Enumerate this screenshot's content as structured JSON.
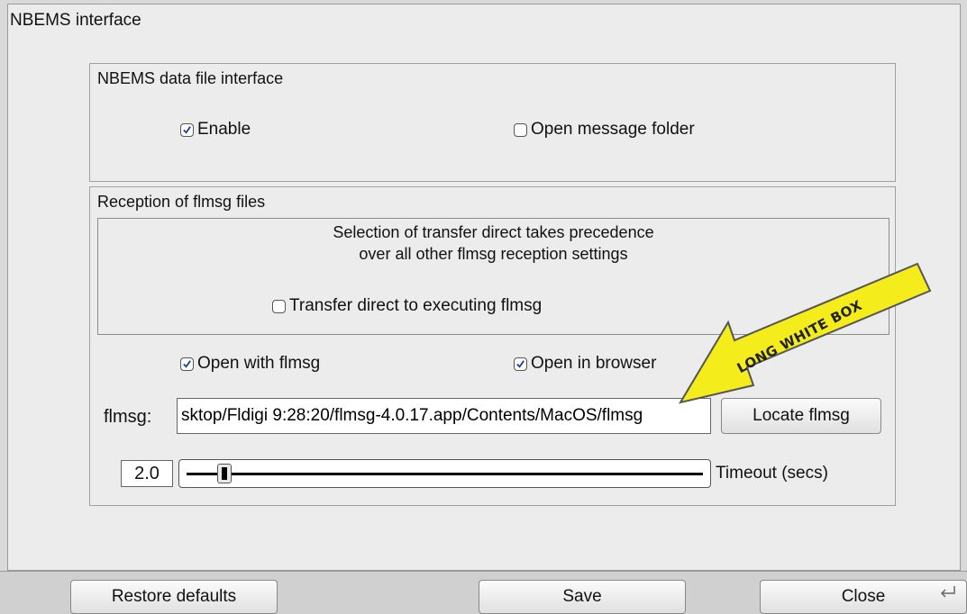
{
  "window": {
    "title": "NBEMS interface"
  },
  "data_file_group": {
    "title": "NBEMS data file interface",
    "enable": {
      "label": "Enable",
      "checked": true
    },
    "open_folder": {
      "label": "Open message folder",
      "checked": false
    }
  },
  "reception_group": {
    "title": "Reception of flmsg files",
    "note_line1": "Selection of transfer direct takes precedence",
    "note_line2": "over all other flmsg reception settings",
    "transfer_direct": {
      "label": "Transfer direct to executing flmsg",
      "checked": false
    },
    "open_with_flmsg": {
      "label": "Open with flmsg",
      "checked": true
    },
    "open_in_browser": {
      "label": "Open in browser",
      "checked": true
    },
    "path_label": "flmsg:",
    "path_value": "sktop/Fldigi 9:28:20/flmsg-4.0.17.app/Contents/MacOS/flmsg",
    "locate_button": "Locate flmsg",
    "timeout_value": "2.0",
    "timeout_label": "Timeout (secs)",
    "timeout_slider_level": 0.06
  },
  "buttons": {
    "restore": "Restore defaults",
    "save": "Save",
    "close": "Close"
  },
  "annotation": {
    "text": "LONG WHITE BOX",
    "arrow_color": "#f5ec1c"
  }
}
